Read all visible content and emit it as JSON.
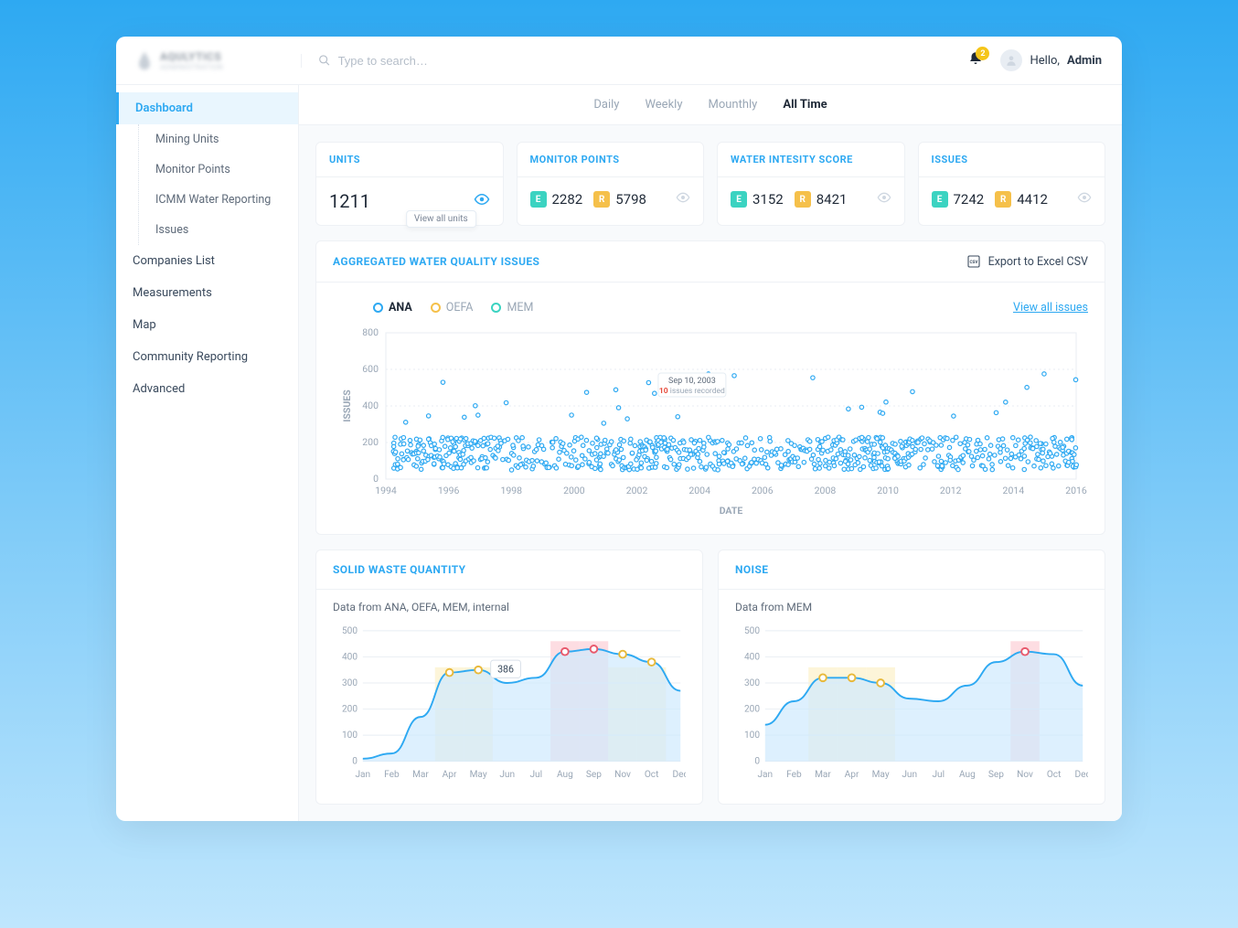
{
  "brand": {
    "name": "AQULYTICS",
    "tagline": "ADMINISTRATION"
  },
  "search": {
    "placeholder": "Type to search…"
  },
  "notifications": {
    "count": "2"
  },
  "greeting": {
    "prefix": "Hello, ",
    "name": "Admin"
  },
  "sidebar": {
    "items": [
      {
        "label": "Dashboard",
        "active": true,
        "children": [
          "Mining Units",
          "Monitor Points",
          "ICMM Water Reporting",
          "Issues"
        ]
      },
      {
        "label": "Companies List"
      },
      {
        "label": "Measurements"
      },
      {
        "label": "Map"
      },
      {
        "label": "Community Reporting"
      },
      {
        "label": "Advanced"
      }
    ]
  },
  "time_tabs": [
    "Daily",
    "Weekly",
    "Mounthly",
    "All Time"
  ],
  "time_tab_active": "All Time",
  "stats": {
    "units": {
      "title": "UNITS",
      "value": "1211",
      "tooltip": "View all units"
    },
    "monitor_points": {
      "title": "MONITOR POINTS",
      "e": "2282",
      "r": "5798"
    },
    "water_intensity": {
      "title": "WATER INTESITY SCORE",
      "e": "3152",
      "r": "8421"
    },
    "issues": {
      "title": "ISSUES",
      "e": "7242",
      "r": "4412"
    }
  },
  "agg_panel": {
    "title": "AGGREGATED WATER QUALITY ISSUES",
    "export_label": "Export to Excel CSV",
    "legend": {
      "ana": "ANA",
      "oefa": "OEFA",
      "mem": "MEM"
    },
    "view_all": "View all issues",
    "tooltip_date": "Sep 10, 2003",
    "tooltip_count": "10",
    "tooltip_suffix": " issues recorded",
    "y_axis": "ISSUES",
    "x_axis": "DATE"
  },
  "waste_panel": {
    "title": "SOLID WASTE QUANTITY",
    "subtitle": "Data from ANA, OEFA, MEM, internal",
    "callout": "386"
  },
  "noise_panel": {
    "title": "NOISE",
    "subtitle": "Data from MEM"
  },
  "chart_data": [
    {
      "type": "scatter",
      "title": "AGGREGATED WATER QUALITY ISSUES",
      "xlabel": "DATE",
      "ylabel": "ISSUES",
      "ylim": [
        0,
        800
      ],
      "xlim": [
        1994,
        2016
      ],
      "x_ticks": [
        1994,
        1996,
        1998,
        2000,
        2002,
        2004,
        2006,
        2008,
        2010,
        2012,
        2014,
        2016
      ],
      "y_ticks": [
        0,
        200,
        400,
        600,
        800
      ],
      "series": [
        {
          "name": "ANA",
          "note": "dense scatter ~50–250 band 1994–2016 with peaks near 400–600 around 2000, 2004, 2007"
        }
      ],
      "tooltip": {
        "date": "Sep 10, 2003",
        "issues": 10
      }
    },
    {
      "type": "line",
      "title": "SOLID WASTE QUANTITY",
      "categories": [
        "Jan",
        "Feb",
        "Mar",
        "Apr",
        "May",
        "Jun",
        "Jul",
        "Aug",
        "Sep",
        "Nov",
        "Oct",
        "Dec"
      ],
      "values": [
        10,
        30,
        170,
        340,
        350,
        300,
        320,
        420,
        430,
        410,
        380,
        270
      ],
      "ylim": [
        0,
        500
      ],
      "y_ticks": [
        0,
        100,
        200,
        300,
        400,
        500
      ],
      "highlights": {
        "yellow": [
          "Apr",
          "May",
          "Nov",
          "Oct"
        ],
        "pink": [
          "Aug",
          "Sep"
        ]
      },
      "callout": {
        "x": "May",
        "value": 386
      }
    },
    {
      "type": "line",
      "title": "NOISE",
      "categories": [
        "Jan",
        "Feb",
        "Mar",
        "Apr",
        "May",
        "Jun",
        "Jul",
        "Aug",
        "Sep",
        "Nov",
        "Oct",
        "Dec"
      ],
      "values": [
        140,
        230,
        320,
        320,
        300,
        240,
        230,
        290,
        380,
        420,
        410,
        290
      ],
      "ylim": [
        0,
        500
      ],
      "y_ticks": [
        0,
        100,
        200,
        300,
        400,
        500
      ],
      "highlights": {
        "yellow": [
          "Mar",
          "Apr",
          "May"
        ],
        "pink": [
          "Nov"
        ]
      }
    }
  ]
}
